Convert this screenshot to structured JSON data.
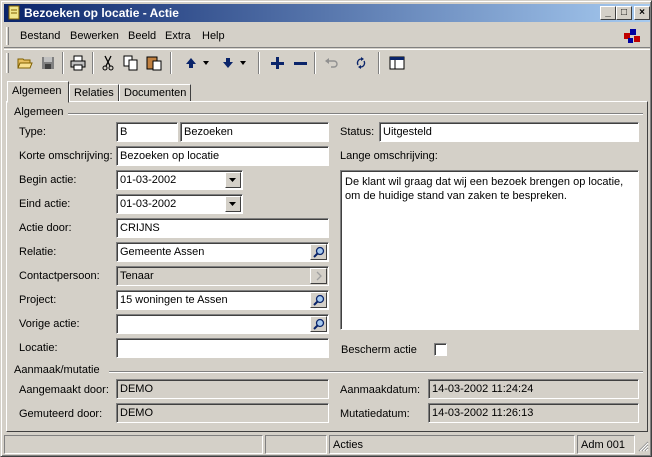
{
  "window": {
    "title": "Bezoeken op locatie - Actie",
    "controls": {
      "minimize": "_",
      "maximize": "□",
      "close": "×"
    }
  },
  "menu": [
    "Bestand",
    "Bewerken",
    "Beeld",
    "Extra",
    "Help"
  ],
  "toolbar": {
    "buttons": [
      "open-icon",
      "save-icon",
      "print-icon",
      "cut-icon",
      "copy-icon",
      "paste-icon",
      "arrow-up-icon",
      "arrow-down-icon",
      "add-icon",
      "remove-icon",
      "undo-icon",
      "refresh-icon",
      "layout-icon"
    ]
  },
  "tabs": [
    "Algemeen",
    "Relaties",
    "Documenten"
  ],
  "algemeen": {
    "group_title": "Algemeen",
    "type_label": "Type:",
    "type_code": "B",
    "type_name": "Bezoeken",
    "korte_label": "Korte omschrijving:",
    "korte_value": "Bezoeken op locatie",
    "begin_label": "Begin actie:",
    "begin_value": "01-03-2002",
    "eind_label": "Eind actie:",
    "eind_value": "01-03-2002",
    "door_label": "Actie door:",
    "door_value": "CRIJNS",
    "relatie_label": "Relatie:",
    "relatie_value": "Gemeente Assen",
    "contact_label": "Contactpersoon:",
    "contact_value": "Tenaar",
    "project_label": "Project:",
    "project_value": "15 woningen te Assen",
    "vorige_label": "Vorige actie:",
    "vorige_value": "",
    "locatie_label": "Locatie:",
    "locatie_value": "",
    "status_label": "Status:",
    "status_value": "Uitgesteld",
    "lange_label": "Lange omschrijving:",
    "lange_value": "De klant wil graag dat wij een bezoek brengen op locatie, om de huidige stand van zaken te bespreken.",
    "bescherm_label": "Bescherm actie",
    "bescherm_checked": false
  },
  "mutatie": {
    "group_title": "Aanmaak/mutatie",
    "aangemaakt_label": "Aangemaakt door:",
    "aangemaakt_value": "DEMO",
    "gemuteerd_label": "Gemuteerd door:",
    "gemuteerd_value": "DEMO",
    "aanmaakdatum_label": "Aanmaakdatum:",
    "aanmaakdatum_value": "14-03-2002 11:24:24",
    "mutatiedatum_label": "Mutatiedatum:",
    "mutatiedatum_value": "14-03-2002 11:26:13"
  },
  "statusbar": [
    "",
    "",
    "Acties",
    "Adm 001"
  ]
}
